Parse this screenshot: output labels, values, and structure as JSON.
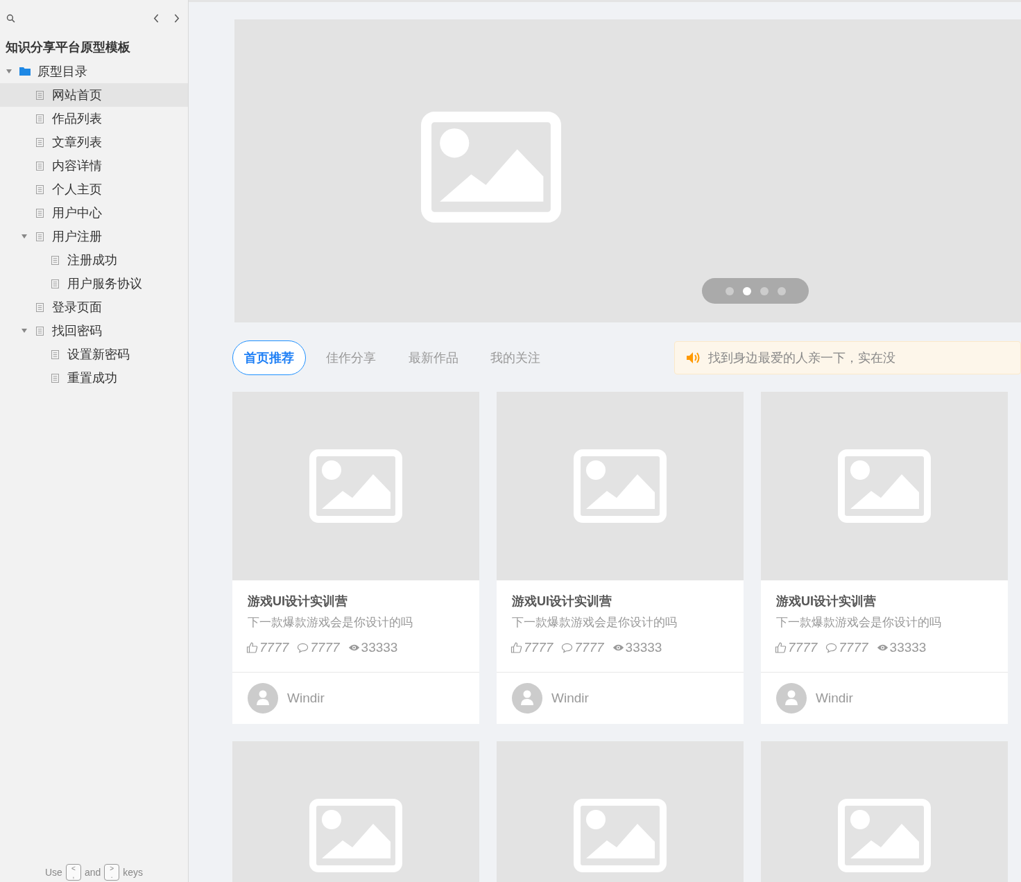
{
  "sidebar": {
    "title": "知识分享平台原型模板",
    "tree": [
      {
        "label": "原型目录",
        "kind": "folder",
        "expanded": true,
        "selected": false,
        "children": [
          {
            "label": "网站首页",
            "kind": "page",
            "selected": true
          },
          {
            "label": "作品列表",
            "kind": "page",
            "selected": false
          },
          {
            "label": "文章列表",
            "kind": "page",
            "selected": false
          },
          {
            "label": "内容详情",
            "kind": "page",
            "selected": false
          },
          {
            "label": "个人主页",
            "kind": "page",
            "selected": false
          },
          {
            "label": "用户中心",
            "kind": "page",
            "selected": false
          },
          {
            "label": "用户注册",
            "kind": "page",
            "selected": false,
            "expanded": true,
            "children": [
              {
                "label": "注册成功",
                "kind": "page",
                "selected": false
              },
              {
                "label": "用户服务协议",
                "kind": "page",
                "selected": false
              }
            ]
          },
          {
            "label": "登录页面",
            "kind": "page",
            "selected": false
          },
          {
            "label": "找回密码",
            "kind": "page",
            "selected": false,
            "expanded": true,
            "children": [
              {
                "label": "设置新密码",
                "kind": "page",
                "selected": false
              },
              {
                "label": "重置成功",
                "kind": "page",
                "selected": false
              }
            ]
          }
        ]
      }
    ],
    "hint": {
      "before": "Use",
      "middle": "and",
      "after": "keys",
      "keys": [
        {
          "top": "<",
          "bottom": ","
        },
        {
          "top": ">",
          "bottom": "."
        }
      ]
    }
  },
  "banner": {
    "dots": [
      {
        "selected": false
      },
      {
        "selected": true
      },
      {
        "selected": false
      },
      {
        "selected": false
      }
    ]
  },
  "tabs": [
    {
      "label": "首页推荐",
      "selected": true
    },
    {
      "label": "佳作分享",
      "selected": false
    },
    {
      "label": "最新作品",
      "selected": false
    },
    {
      "label": "我的关注",
      "selected": false
    }
  ],
  "notice": {
    "text": "找到身边最爱的人亲一下，实在没"
  },
  "cards": [
    {
      "kind": "full",
      "title": "游戏UI设计实训营",
      "subtitle": "下一款爆款游戏会是你设计的吗",
      "likes": "7777",
      "comments": "7777",
      "views": "33333",
      "author": "Windir"
    },
    {
      "kind": "full",
      "title": "游戏UI设计实训营",
      "subtitle": "下一款爆款游戏会是你设计的吗",
      "likes": "7777",
      "comments": "7777",
      "views": "33333",
      "author": "Windir"
    },
    {
      "kind": "full",
      "title": "游戏UI设计实训营",
      "subtitle": "下一款爆款游戏会是你设计的吗",
      "likes": "7777",
      "comments": "7777",
      "views": "33333",
      "author": "Windir"
    },
    {
      "kind": "image_only"
    },
    {
      "kind": "image_only"
    },
    {
      "kind": "image_only"
    }
  ]
}
